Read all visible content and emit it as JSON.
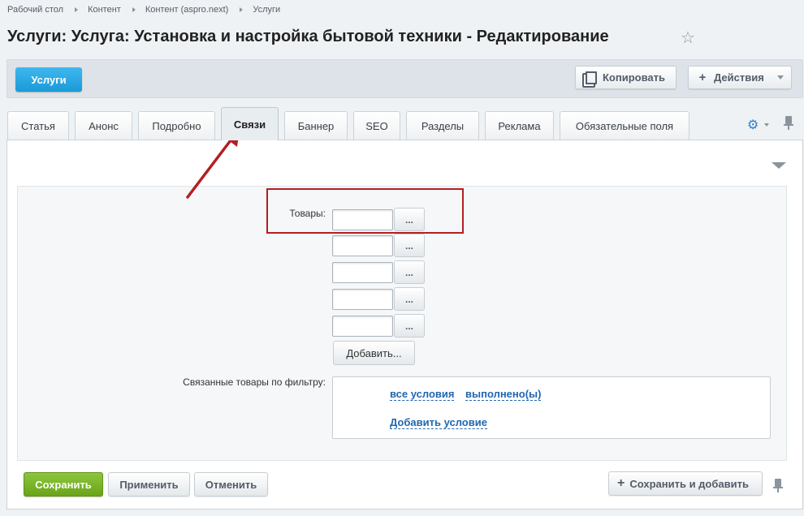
{
  "breadcrumbs": [
    "Рабочий стол",
    "Контент",
    "Контент (aspro.next)",
    "Услуги"
  ],
  "page_title": "Услуги: Услуга: Установка и настройка бытовой техники - Редактирование",
  "toolbar": {
    "back_label": "Услуги",
    "copy_label": "Копировать",
    "actions_label": "Действия"
  },
  "tabs": [
    {
      "label": "Статья"
    },
    {
      "label": "Анонс"
    },
    {
      "label": "Подробно"
    },
    {
      "label": "Связи",
      "active": true
    },
    {
      "label": "Баннер"
    },
    {
      "label": "SEO"
    },
    {
      "label": "Разделы"
    },
    {
      "label": "Реклама"
    },
    {
      "label": "Обязательные поля"
    }
  ],
  "form": {
    "goods_label": "Товары:",
    "goods_inputs": [
      "",
      "",
      "",
      "",
      ""
    ],
    "browse_label": "...",
    "add_label": "Добавить...",
    "filter_label": "Связанные товары по фильтру:",
    "filter_all_conditions": "все условия",
    "filter_fulfilled": "выполнено(ы)",
    "filter_add_condition": "Добавить условие"
  },
  "buttons": {
    "save": "Сохранить",
    "apply": "Применить",
    "cancel": "Отменить",
    "save_and_add": "Сохранить и добавить"
  },
  "colors": {
    "accent_blue": "#1a9ad8",
    "save_green": "#6aa417",
    "annotation_red": "#b21f24",
    "link_blue": "#2067b0"
  }
}
